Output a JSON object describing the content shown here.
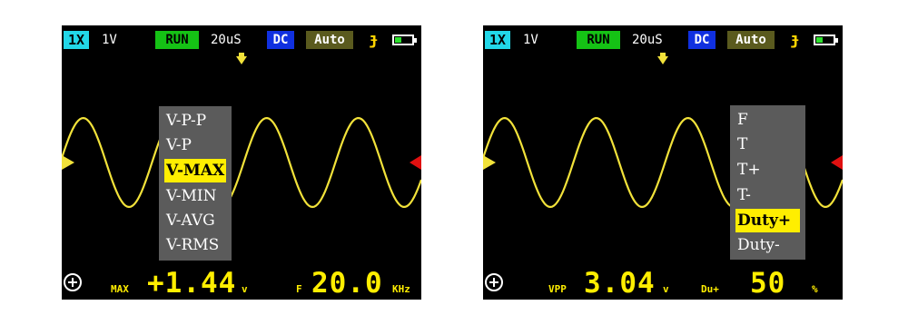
{
  "colors": {
    "trace": "#f2e23a",
    "accent": "#ffee00",
    "run": "#15c215",
    "probe": "#22d7e8",
    "dc": "#1030e0",
    "auto": "#5a5a1e",
    "menu_bg": "#5b5b5b"
  },
  "icons": {
    "add": "plus-circle-icon",
    "trigger": "trigger-edge-icon",
    "battery": "battery-icon",
    "ch_marker_left": "channel-marker-icon",
    "ch_marker_right": "trigger-level-marker-icon"
  },
  "left": {
    "topbar": {
      "probe": "1X",
      "volts": "1V",
      "run": "RUN",
      "timebase": "20uS",
      "coupling": "DC",
      "mode": "Auto",
      "trigger": "ɟ"
    },
    "menu": {
      "items": [
        "V-P-P",
        "V-P",
        "V-MAX",
        "V-MIN",
        "V-AVG",
        "V-RMS"
      ],
      "selected": "V-MAX"
    },
    "bottom": {
      "m1_label": "MAX",
      "m1_value": "+1.44",
      "m1_unit": "v",
      "m2_label": "F",
      "m2_value": "20.0",
      "m2_unit": "KHz"
    }
  },
  "right": {
    "topbar": {
      "probe": "1X",
      "volts": "1V",
      "run": "RUN",
      "timebase": "20uS",
      "coupling": "DC",
      "mode": "Auto",
      "trigger": "ɟ"
    },
    "menu": {
      "items": [
        "F",
        "T",
        "T+",
        "T-",
        "Duty+",
        "Duty-"
      ],
      "selected": "Duty+"
    },
    "bottom": {
      "m1_label": "VPP",
      "m1_value": "3.04",
      "m1_unit": "v",
      "m2_label": "Du+",
      "m2_value": "50",
      "m2_unit": "%"
    }
  }
}
